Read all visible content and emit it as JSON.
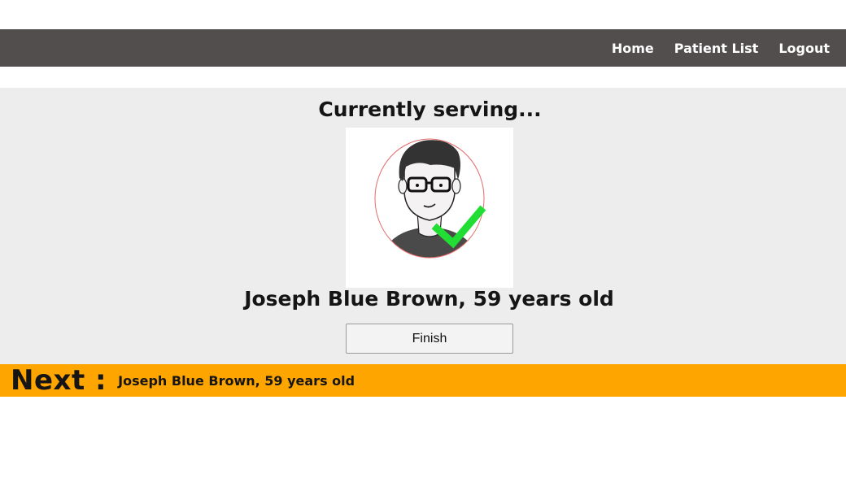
{
  "nav": {
    "items": [
      {
        "label": "Home"
      },
      {
        "label": "Patient List"
      },
      {
        "label": "Logout"
      }
    ]
  },
  "serving": {
    "heading": "Currently serving...",
    "avatar_icon": "served-patient-avatar-with-checkmark",
    "patient": "Joseph Blue Brown, 59 years old",
    "finish_label": "Finish"
  },
  "next": {
    "label": "Next :",
    "patient": "Joseph Blue Brown, 59 years old"
  },
  "colors": {
    "navbar": "#524e4e",
    "panel": "#eeedee",
    "next_bar": "#ffa500",
    "check": "#22dd33"
  }
}
